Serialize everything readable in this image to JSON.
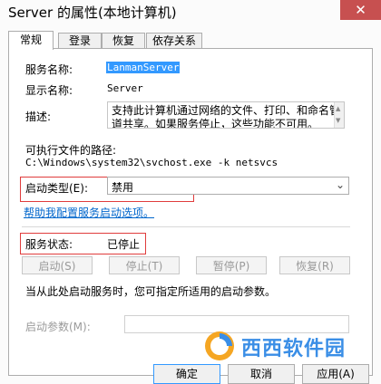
{
  "window": {
    "title": "Server 的属性(本地计算机)",
    "close_glyph": "✕"
  },
  "tabs": [
    "常规",
    "登录",
    "恢复",
    "依存关系"
  ],
  "general": {
    "service_name_label": "服务名称:",
    "service_name_value": "LanmanServer",
    "display_name_label": "显示名称:",
    "display_name_value": "Server",
    "description_label": "描述:",
    "description_text": "支持此计算机通过网络的文件、打印、和命名管道共享。如果服务停止，这些功能不可用。",
    "exec_path_label": "可执行文件的路径:",
    "exec_path_value": "C:\\Windows\\system32\\svchost.exe -k netsvcs",
    "startup_type_label": "启动类型(E):",
    "startup_type_value": "禁用",
    "help_link": "帮助我配置服务启动选项。",
    "status_label": "服务状态:",
    "status_value": "已停止",
    "buttons": {
      "start": "启动(S)",
      "stop": "停止(T)",
      "pause": "暂停(P)",
      "resume": "恢复(R)"
    },
    "hint": "当从此处启动服务时，您可指定所适用的启动参数。",
    "start_params_label": "启动参数(M):",
    "start_params_value": ""
  },
  "dialog_buttons": {
    "ok": "确定",
    "cancel": "取消",
    "apply": "应用(A)"
  },
  "watermark": {
    "text": "西西软件园"
  },
  "colors": {
    "accent": "#3399ff",
    "highlight_box": "#e03c3c",
    "close": "#c75050",
    "link": "#0066cc"
  }
}
